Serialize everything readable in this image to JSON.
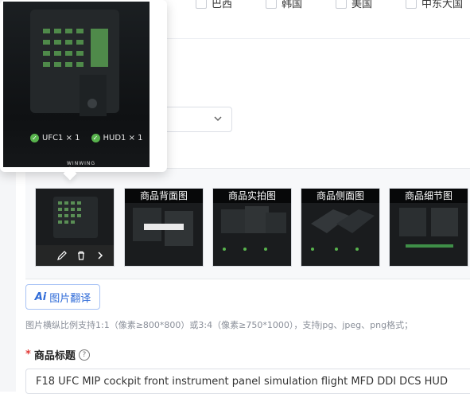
{
  "checkbox_row": [
    "巴西",
    "韩国",
    "美国",
    "中东大国"
  ],
  "preview": {
    "legend": [
      {
        "icon": "check-circle-icon",
        "label": "UFC1 × 1"
      },
      {
        "icon": "check-circle-icon",
        "label": "HUD1 × 1"
      }
    ],
    "brand": "WINWING"
  },
  "thumbnails": [
    {
      "caption": "",
      "has_actions": true
    },
    {
      "caption": "商品背面图",
      "has_actions": false
    },
    {
      "caption": "商品实拍图",
      "has_actions": false
    },
    {
      "caption": "商品侧面图",
      "has_actions": false
    },
    {
      "caption": "商品细节图",
      "has_actions": false
    }
  ],
  "translate_button": {
    "ai": "Ai",
    "label": "图片翻译"
  },
  "hint_text": "图片横纵比例支持1:1（像素≥800*800）或3:4（像素≥750*1000），支持jpg、jpeg、png格式；",
  "title_field": {
    "label": "商品标题",
    "value": "F18 UFC MIP cockpit front instrument panel simulation flight MFD DDI DCS HUD"
  },
  "colors": {
    "accent": "#2f6bd8",
    "required": "#e23c39",
    "check": "#58b34d"
  }
}
